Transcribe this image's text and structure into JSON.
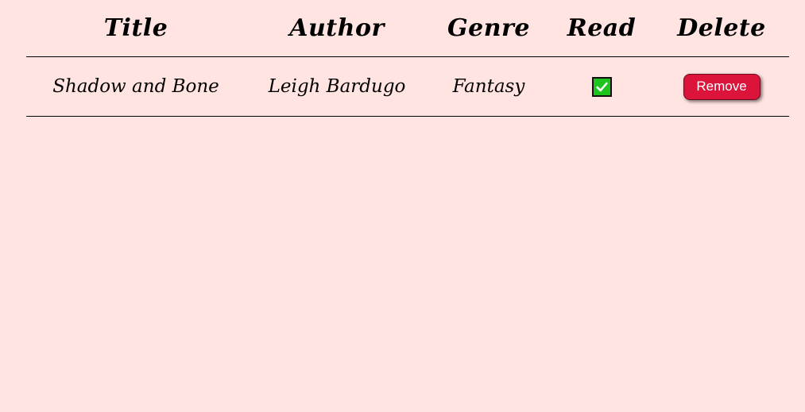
{
  "table": {
    "headers": {
      "title": "Title",
      "author": "Author",
      "genre": "Genre",
      "read": "Read",
      "delete": "Delete"
    },
    "rows": [
      {
        "title": "Shadow and Bone",
        "author": "Leigh Bardugo",
        "genre": "Fantasy",
        "read": true,
        "delete_label": "Remove"
      }
    ]
  },
  "colors": {
    "background": "#ffe4e1",
    "remove_button": "#dc143c",
    "checkbox_checked": "#1ec41e"
  },
  "icons": {
    "read_checkbox": "checkmark-icon"
  }
}
